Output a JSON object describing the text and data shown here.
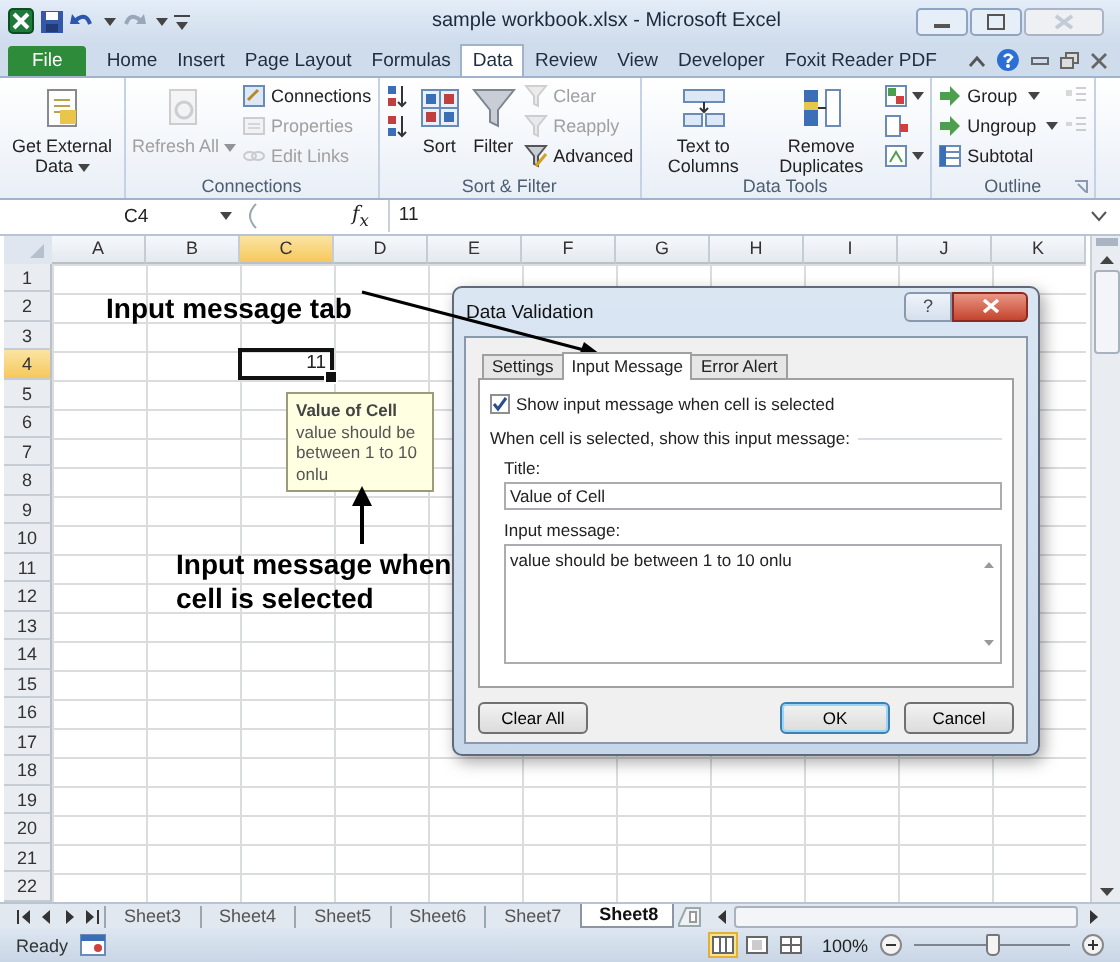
{
  "window": {
    "title": "sample workbook.xlsx - Microsoft Excel"
  },
  "ribbon": {
    "tabs": [
      {
        "label": "File",
        "kind": "file",
        "selected": false
      },
      {
        "label": "Home",
        "kind": "tab",
        "selected": false
      },
      {
        "label": "Insert",
        "kind": "tab",
        "selected": false
      },
      {
        "label": "Page Layout",
        "kind": "tab",
        "selected": false
      },
      {
        "label": "Formulas",
        "kind": "tab",
        "selected": false
      },
      {
        "label": "Data",
        "kind": "tab",
        "selected": true
      },
      {
        "label": "Review",
        "kind": "tab",
        "selected": false
      },
      {
        "label": "View",
        "kind": "tab",
        "selected": false
      },
      {
        "label": "Developer",
        "kind": "tab",
        "selected": false
      },
      {
        "label": "Foxit Reader PDF",
        "kind": "tab",
        "selected": false
      }
    ],
    "groups": [
      {
        "items": [
          {
            "kind": "large",
            "label": "Get External Data",
            "dropdown": true,
            "disabled": false
          }
        ]
      },
      {
        "label": "Connections",
        "items": [
          {
            "kind": "large",
            "label": "Refresh All",
            "dropdown": true,
            "disabled": true
          },
          {
            "kind": "small",
            "label": "Connections",
            "disabled": false
          },
          {
            "kind": "small",
            "label": "Properties",
            "disabled": true
          },
          {
            "kind": "small",
            "label": "Edit Links",
            "disabled": true
          }
        ]
      },
      {
        "label": "Sort & Filter",
        "items": [
          {
            "kind": "icon",
            "disabled": false
          },
          {
            "kind": "icon",
            "disabled": false
          },
          {
            "kind": "large",
            "label": "Sort",
            "disabled": false
          },
          {
            "kind": "large",
            "label": "Filter",
            "disabled": false
          },
          {
            "kind": "small",
            "label": "Clear",
            "disabled": true
          },
          {
            "kind": "small",
            "label": "Reapply",
            "disabled": true
          },
          {
            "kind": "small",
            "label": "Advanced",
            "disabled": false
          }
        ]
      },
      {
        "label": "Data Tools",
        "items": [
          {
            "kind": "large",
            "label": "Text to Columns",
            "disabled": false
          },
          {
            "kind": "large",
            "label": "Remove Duplicates",
            "disabled": false
          },
          {
            "kind": "icon",
            "dropdown": true,
            "disabled": false
          },
          {
            "kind": "icon",
            "disabled": false
          },
          {
            "kind": "icon",
            "dropdown": true,
            "disabled": false
          }
        ]
      },
      {
        "label": "Outline",
        "dialog_launcher": true,
        "items": [
          {
            "kind": "small",
            "label": "Group",
            "dropdown": true,
            "disabled": false
          },
          {
            "kind": "small",
            "label": "Ungroup",
            "dropdown": true,
            "disabled": false
          },
          {
            "kind": "small",
            "label": "Subtotal",
            "disabled": false
          },
          {
            "kind": "icon",
            "disabled": true
          },
          {
            "kind": "icon",
            "disabled": true
          }
        ]
      }
    ]
  },
  "formula_bar": {
    "name_box": "C4",
    "function_label": "f$_{x}$",
    "formula": "11"
  },
  "sheet": {
    "columns": [
      {
        "label": "A",
        "selected": false
      },
      {
        "label": "B",
        "selected": false
      },
      {
        "label": "C",
        "selected": true
      },
      {
        "label": "D",
        "selected": false
      },
      {
        "label": "E",
        "selected": false
      },
      {
        "label": "F",
        "selected": false
      },
      {
        "label": "G",
        "selected": false
      },
      {
        "label": "H",
        "selected": false
      },
      {
        "label": "I",
        "selected": false
      },
      {
        "label": "J",
        "selected": false
      },
      {
        "label": "K",
        "selected": false
      }
    ],
    "rows": [
      {
        "label": "1",
        "selected": false
      },
      {
        "label": "2",
        "selected": false
      },
      {
        "label": "3",
        "selected": false
      },
      {
        "label": "4",
        "selected": true,
        "cells": [
          null,
          null,
          {
            "value": "11",
            "selected": true
          }
        ]
      },
      {
        "label": "5",
        "selected": false
      },
      {
        "label": "6",
        "selected": false
      },
      {
        "label": "7",
        "selected": false
      },
      {
        "label": "8",
        "selected": false
      },
      {
        "label": "9",
        "selected": false
      },
      {
        "label": "10",
        "selected": false
      },
      {
        "label": "11",
        "selected": false
      },
      {
        "label": "12",
        "selected": false
      },
      {
        "label": "13",
        "selected": false
      },
      {
        "label": "14",
        "selected": false
      },
      {
        "label": "15",
        "selected": false
      },
      {
        "label": "16",
        "selected": false
      },
      {
        "label": "17",
        "selected": false
      },
      {
        "label": "18",
        "selected": false
      },
      {
        "label": "19",
        "selected": false
      },
      {
        "label": "20",
        "selected": false
      },
      {
        "label": "21",
        "selected": false
      },
      {
        "label": "22",
        "selected": false
      }
    ]
  },
  "input_tooltip": {
    "title": "Value of Cell",
    "message": "value should be between 1 to 10 onlu"
  },
  "annotations": [
    {
      "text": "Input message tab"
    },
    {
      "text": "Input message when cell is selected"
    }
  ],
  "dialog": {
    "title": "Data Validation",
    "help_button": "?",
    "tabs": [
      {
        "label": "Settings",
        "selected": false
      },
      {
        "label": "Input Message",
        "selected": true
      },
      {
        "label": "Error Alert",
        "selected": false
      }
    ],
    "show_message": {
      "label": "Show input message when cell is selected",
      "checked": true
    },
    "section_label": "When cell is selected, show this input message:",
    "title_label": "Title:",
    "title_value": "Value of Cell",
    "message_label": "Input message:",
    "message_value": "value should be between 1 to 10 onlu",
    "buttons": [
      {
        "label": "Clear All",
        "default": false
      },
      {
        "label": "OK",
        "default": true
      },
      {
        "label": "Cancel",
        "default": false
      }
    ]
  },
  "sheet_tabs": [
    {
      "label": "Sheet3",
      "selected": false
    },
    {
      "label": "Sheet4",
      "selected": false
    },
    {
      "label": "Sheet5",
      "selected": false
    },
    {
      "label": "Sheet6",
      "selected": false
    },
    {
      "label": "Sheet7",
      "selected": false
    },
    {
      "label": "Sheet8",
      "selected": true
    }
  ],
  "status_bar": {
    "text": "Ready",
    "views": [
      {
        "kind": "normal",
        "selected": true
      },
      {
        "kind": "page-layout",
        "selected": false
      },
      {
        "kind": "page-break",
        "selected": false
      }
    ],
    "zoom": "100%",
    "zoom_slider": {
      "level": 0.5
    }
  }
}
